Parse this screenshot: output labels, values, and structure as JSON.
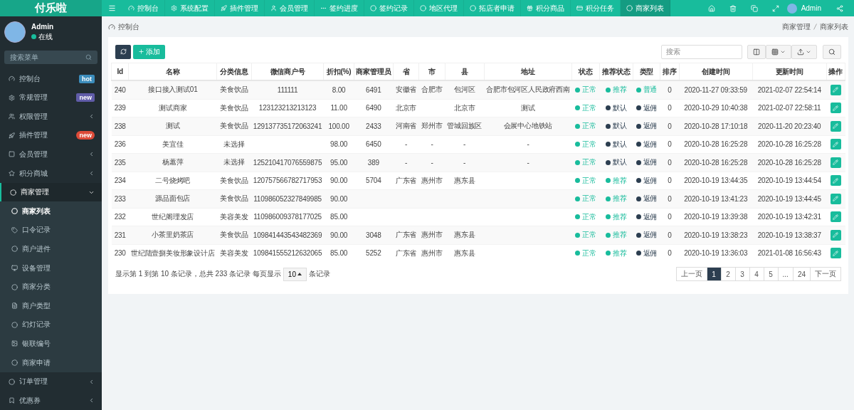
{
  "logo": "付乐啦",
  "top_nav": [
    {
      "label": "控制台",
      "selected": false
    },
    {
      "label": "系统配置",
      "selected": false
    },
    {
      "label": "插件管理",
      "selected": false
    },
    {
      "label": "会员管理",
      "selected": false
    },
    {
      "label": "签约进度",
      "selected": false
    },
    {
      "label": "签约记录",
      "selected": false
    },
    {
      "label": "地区代理",
      "selected": false
    },
    {
      "label": "拓店者申请",
      "selected": false
    },
    {
      "label": "积分商品",
      "selected": false
    },
    {
      "label": "积分任务",
      "selected": false
    },
    {
      "label": "商家列表",
      "selected": true
    }
  ],
  "top_user": "Admin",
  "user": {
    "name": "Admin",
    "status": "在线"
  },
  "menu_search": {
    "placeholder": "搜索菜单"
  },
  "sidebar": {
    "items": [
      {
        "label": "控制台",
        "badge": {
          "text": "hot",
          "color": "#3c8dbc"
        }
      },
      {
        "label": "常规管理",
        "badge": {
          "text": "new",
          "color": "#605ca8"
        }
      },
      {
        "label": "权限管理",
        "expanded": false
      },
      {
        "label": "插件管理",
        "badge": {
          "text": "new",
          "color": "#dd4b39"
        }
      },
      {
        "label": "会员管理",
        "expanded": false
      },
      {
        "label": "积分商城",
        "expanded": false
      },
      {
        "label": "商家管理",
        "expanded": true,
        "children": [
          {
            "label": "商家列表",
            "selected": true
          },
          {
            "label": "口令记录",
            "selected": false
          },
          {
            "label": "商户进件",
            "selected": false
          },
          {
            "label": "设备管理",
            "selected": false
          },
          {
            "label": "商家分类",
            "selected": false
          },
          {
            "label": "商户类型",
            "selected": false
          },
          {
            "label": "幻灯记录",
            "selected": false
          },
          {
            "label": "银联编号",
            "selected": false
          },
          {
            "label": "商家申请",
            "selected": false
          }
        ]
      },
      {
        "label": "订单管理",
        "expanded": false
      },
      {
        "label": "优惠券",
        "expanded": false
      }
    ]
  },
  "breadcrumb": {
    "home": "控制台",
    "trail": [
      "商家管理",
      "商家列表"
    ]
  },
  "toolbar": {
    "add": "添加",
    "search": {
      "placeholder": "搜索"
    }
  },
  "table": {
    "columns": [
      "Id",
      "名称",
      "分类信息",
      "微信商户号",
      "折扣(%)",
      "商家管理员",
      "省",
      "市",
      "县",
      "地址",
      "状态",
      "推荐状态",
      "类型",
      "排序",
      "创建时间",
      "更新时间",
      "操作"
    ],
    "rows": [
      {
        "id": "240",
        "name": "接口接入测试01",
        "category": "美食饮品",
        "wechat_id": "111111",
        "discount": "8.00",
        "manager": "6491",
        "province": "安徽省",
        "city": "合肥市",
        "county": "包河区",
        "address": "合肥市包河区人民政府西南",
        "status": {
          "text": "正常",
          "color": "#18bc9c"
        },
        "recommend": {
          "text": "推荐",
          "color": "#18bc9c"
        },
        "type": {
          "text": "普通",
          "color": "#18bc9c"
        },
        "sort": "0",
        "created": "2020-11-27 09:33:59",
        "updated": "2021-02-07 22:54:14"
      },
      {
        "id": "239",
        "name": "测试商家",
        "category": "美食饮品",
        "wechat_id": "123123213213123",
        "discount": "11.00",
        "manager": "6490",
        "province": "北京市",
        "county": "北京市",
        "address": "测试",
        "status": {
          "text": "正常",
          "color": "#18bc9c"
        },
        "recommend": {
          "text": "默认",
          "color": "#2c3e50"
        },
        "type": {
          "text": "返佣",
          "color": "#2c3e50"
        },
        "sort": "0",
        "created": "2020-10-29 10:40:38",
        "updated": "2021-02-07 22:58:11"
      },
      {
        "id": "238",
        "name": "测试",
        "category": "美食饮品",
        "wechat_id": "129137735172063241",
        "discount": "100.00",
        "manager": "2433",
        "province": "河南省",
        "city": "郑州市",
        "county": "管城回族区",
        "address": "会展中心地铁站",
        "status": {
          "text": "正常",
          "color": "#18bc9c"
        },
        "recommend": {
          "text": "默认",
          "color": "#2c3e50"
        },
        "type": {
          "text": "返佣",
          "color": "#2c3e50"
        },
        "sort": "0",
        "created": "2020-10-28 17:10:18",
        "updated": "2020-11-20 20:23:40"
      },
      {
        "id": "236",
        "name": "美宜佳",
        "category": "未选择",
        "discount": "98.00",
        "manager": "6450",
        "province": "-",
        "city": "-",
        "county": "-",
        "address": "-",
        "status": {
          "text": "正常",
          "color": "#18bc9c"
        },
        "recommend": {
          "text": "默认",
          "color": "#2c3e50"
        },
        "type": {
          "text": "返佣",
          "color": "#2c3e50"
        },
        "sort": "0",
        "created": "2020-10-28 16:25:28",
        "updated": "2020-10-28 16:25:28"
      },
      {
        "id": "235",
        "name": "杨蕙萍",
        "category": "未选择",
        "wechat_id": "125210417076559875",
        "discount": "95.00",
        "manager": "389",
        "province": "-",
        "city": "-",
        "county": "-",
        "address": "-",
        "status": {
          "text": "正常",
          "color": "#18bc9c"
        },
        "recommend": {
          "text": "默认",
          "color": "#2c3e50"
        },
        "type": {
          "text": "返佣",
          "color": "#2c3e50"
        },
        "sort": "0",
        "created": "2020-10-28 16:25:28",
        "updated": "2020-10-28 16:25:28"
      },
      {
        "id": "234",
        "name": "二号烧烤吧",
        "category": "美食饮品",
        "wechat_id": "120757566782717953",
        "discount": "90.00",
        "manager": "5704",
        "province": "广东省",
        "city": "惠州市",
        "county": "惠东县",
        "status": {
          "text": "正常",
          "color": "#18bc9c"
        },
        "recommend": {
          "text": "推荐",
          "color": "#18bc9c"
        },
        "type": {
          "text": "返佣",
          "color": "#2c3e50"
        },
        "sort": "0",
        "created": "2020-10-19 13:44:35",
        "updated": "2020-10-19 13:44:54"
      },
      {
        "id": "233",
        "name": "源品面包店",
        "category": "美食饮品",
        "wechat_id": "110986052327849985",
        "discount": "90.00",
        "status": {
          "text": "正常",
          "color": "#18bc9c"
        },
        "recommend": {
          "text": "推荐",
          "color": "#18bc9c"
        },
        "type": {
          "text": "返佣",
          "color": "#2c3e50"
        },
        "sort": "0",
        "created": "2020-10-19 13:41:23",
        "updated": "2020-10-19 13:44:45"
      },
      {
        "id": "232",
        "name": "世纪阁理发店",
        "category": "美容美发",
        "wechat_id": "110986009378177025",
        "discount": "85.00",
        "status": {
          "text": "正常",
          "color": "#18bc9c"
        },
        "recommend": {
          "text": "推荐",
          "color": "#18bc9c"
        },
        "type": {
          "text": "返佣",
          "color": "#2c3e50"
        },
        "sort": "0",
        "created": "2020-10-19 13:39:38",
        "updated": "2020-10-19 13:42:31"
      },
      {
        "id": "231",
        "name": "小茶里奶茶店",
        "category": "美食饮品",
        "wechat_id": "109841443543482369",
        "discount": "90.00",
        "manager": "3048",
        "province": "广东省",
        "city": "惠州市",
        "county": "惠东县",
        "status": {
          "text": "正常",
          "color": "#18bc9c"
        },
        "recommend": {
          "text": "推荐",
          "color": "#18bc9c"
        },
        "type": {
          "text": "返佣",
          "color": "#2c3e50"
        },
        "sort": "0",
        "created": "2020-10-19 13:38:23",
        "updated": "2020-10-19 13:38:37"
      },
      {
        "id": "230",
        "name": "世纪陆壹捌美妆形象设计店",
        "category": "美容美发",
        "wechat_id": "109841555212632065",
        "discount": "85.00",
        "manager": "5252",
        "province": "广东省",
        "city": "惠州市",
        "county": "惠东县",
        "status": {
          "text": "正常",
          "color": "#18bc9c"
        },
        "recommend": {
          "text": "推荐",
          "color": "#18bc9c"
        },
        "type": {
          "text": "返佣",
          "color": "#2c3e50"
        },
        "sort": "0",
        "created": "2020-10-19 13:36:03",
        "updated": "2021-01-08 16:56:43"
      }
    ]
  },
  "footer": {
    "summary": "显示第 1 到第 10 条记录，总共 233 条记录 每页显示",
    "page_size": "10",
    "suffix": "条记录"
  },
  "pagination": [
    {
      "label": "上一页",
      "selected": false
    },
    {
      "label": "1",
      "selected": true
    },
    {
      "label": "2",
      "selected": false
    },
    {
      "label": "3",
      "selected": false
    },
    {
      "label": "4",
      "selected": false
    },
    {
      "label": "5",
      "selected": false
    },
    {
      "label": "...",
      "selected": false
    },
    {
      "label": "24",
      "selected": false
    },
    {
      "label": "下一页",
      "selected": false
    }
  ]
}
